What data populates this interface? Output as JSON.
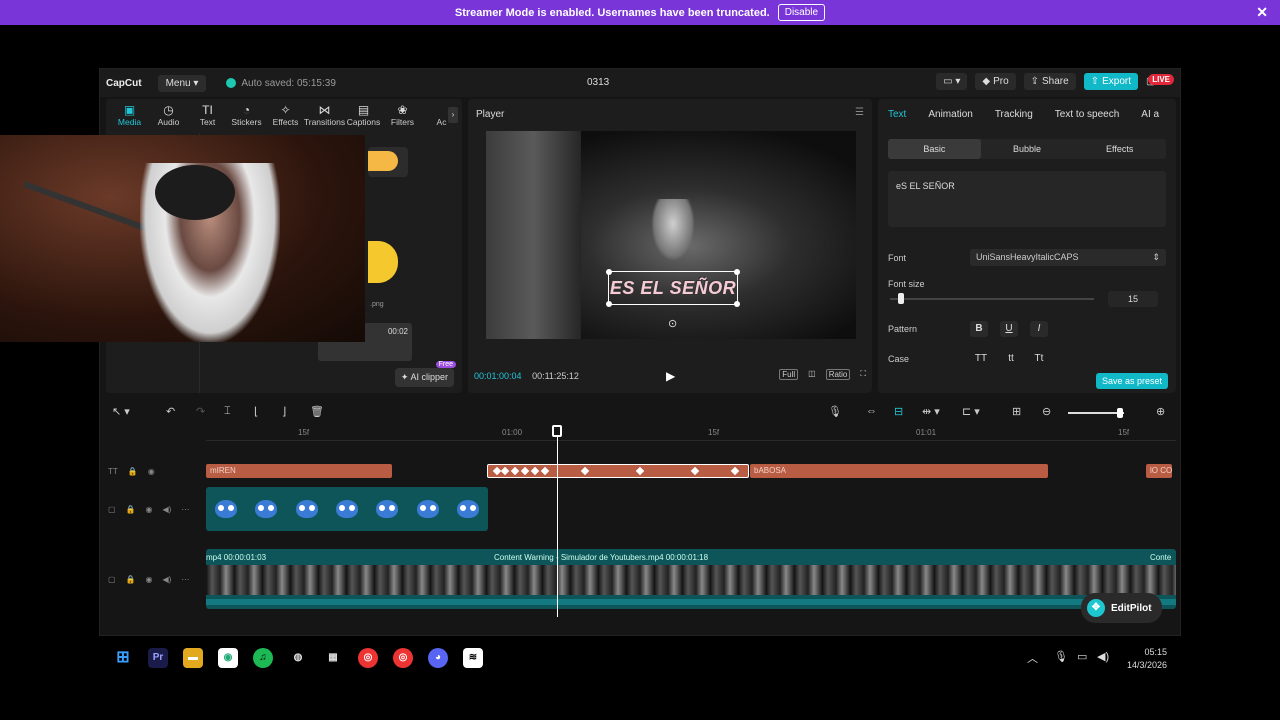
{
  "banner": {
    "message": "Streamer Mode is enabled. Usernames have been truncated.",
    "disable_label": "Disable",
    "close": "✕"
  },
  "titlebar": {
    "logo": "CapCut",
    "menu_label": "Menu ▾",
    "autosave": "Auto saved: 05:15:39",
    "project": "0313",
    "pro_label": "Pro",
    "share_label": "Share",
    "export_label": "Export",
    "live_label": "LIVE"
  },
  "media_tabs": [
    {
      "label": "Media",
      "icon": "▣"
    },
    {
      "label": "Audio",
      "icon": "◷"
    },
    {
      "label": "Text",
      "icon": "TI"
    },
    {
      "label": "Stickers",
      "icon": "◔"
    },
    {
      "label": "Effects",
      "icon": "✧"
    },
    {
      "label": "Transitions",
      "icon": "⋈"
    },
    {
      "label": "Captions",
      "icon": "▤"
    },
    {
      "label": "Filters",
      "icon": "❀"
    },
    {
      "label": "Ac",
      "icon": ""
    }
  ],
  "media": {
    "thumb_time": "00:02",
    "thumb_file": ".png",
    "ai_clipper": "AI clipper",
    "free_tag": "Free"
  },
  "player": {
    "title": "Player",
    "caption": "ES EL SEÑOR",
    "current_time": "00:01:00:04",
    "duration": "00:11:25:12",
    "tool_full": "Full",
    "tool_ratio": "Ratio"
  },
  "props": {
    "tabs": [
      "Text",
      "Animation",
      "Tracking",
      "Text to speech",
      "AI a"
    ],
    "subtabs": [
      "Basic",
      "Bubble",
      "Effects"
    ],
    "text_value": "eS EL SEÑOR",
    "font_label": "Font",
    "font_value": "UniSansHeavyItalicCAPS",
    "font_size_label": "Font size",
    "font_size_value": "15",
    "font_size_fraction": 0.04,
    "pattern_label": "Pattern",
    "pattern_buttons": [
      "B",
      "U",
      "I"
    ],
    "case_label": "Case",
    "case_buttons": [
      "TT",
      "tt",
      "Tt"
    ],
    "save_preset": "Save as preset"
  },
  "timeline": {
    "ruler": [
      "15f",
      "01:00",
      "15f",
      "01:01",
      "15f"
    ],
    "text_clips": [
      "mIREN",
      "",
      "bABOSA",
      "lO CO"
    ],
    "video_labels": [
      "mp4  00:00:01:03",
      "Content Warning - Simulador de Youtubers.mp4  00:00:01:18",
      "Conte"
    ],
    "editpilot": "EditPilot"
  },
  "taskbar": {
    "apps": [
      "⊞",
      "Pr",
      "▬",
      "◉",
      "♫",
      "◍",
      "▦",
      "◎",
      "◎",
      "◕",
      "≋"
    ],
    "time": "05:15",
    "date": "14/3/2026"
  }
}
